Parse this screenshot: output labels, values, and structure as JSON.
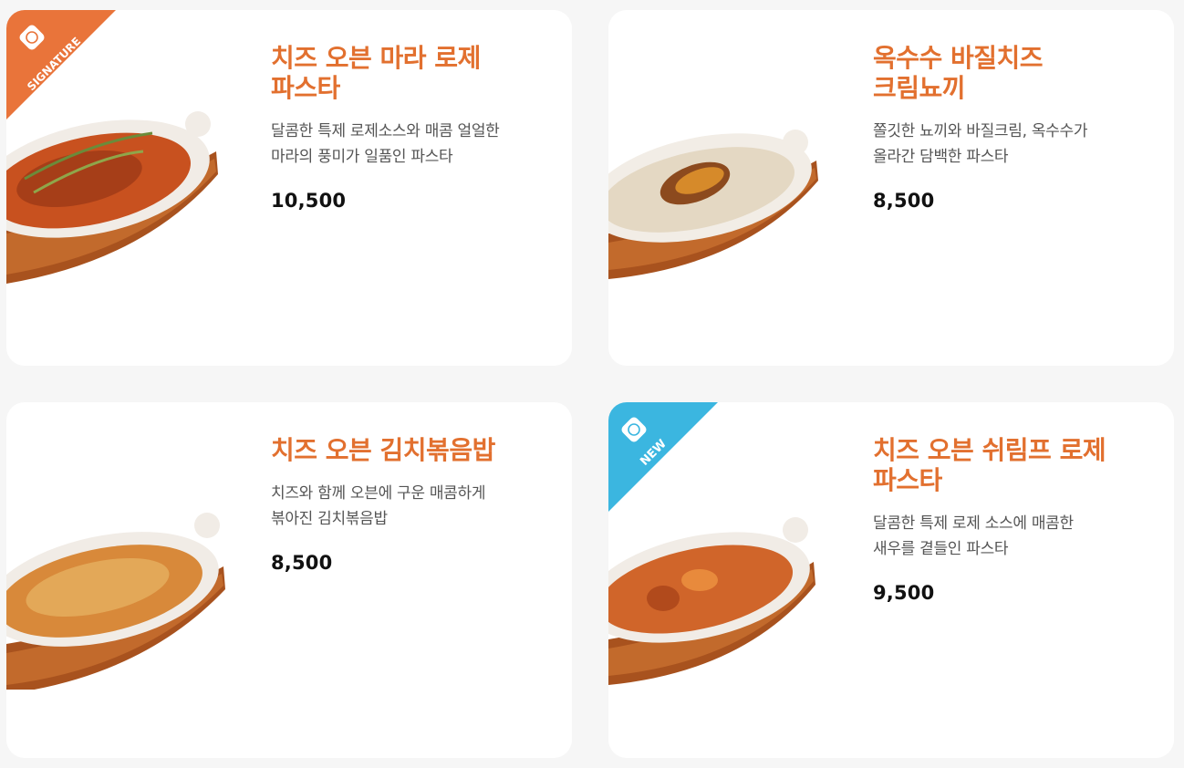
{
  "colors": {
    "title": "#e2702f",
    "signature_badge": "#e9743a",
    "new_badge": "#3bb6e0"
  },
  "menu": [
    {
      "title_lines": [
        "치즈 오븐 마라 로제",
        "파스타"
      ],
      "desc_lines": [
        "달콤한 특제 로제소스와 매콤 얼얼한",
        "마라의 풍미가 일품인 파스타"
      ],
      "price": "10,500",
      "badge": "SIGNATURE"
    },
    {
      "title_lines": [
        "옥수수 바질치즈",
        "크림뇨끼"
      ],
      "desc_lines": [
        "쫄깃한 뇨끼와 바질크림, 옥수수가",
        "올라간 담백한 파스타"
      ],
      "price": "8,500",
      "badge": ""
    },
    {
      "title_lines": [
        "치즈 오븐 김치볶음밥"
      ],
      "desc_lines": [
        "치즈와 함께 오븐에 구운 매콤하게",
        "볶아진 김치볶음밥"
      ],
      "price": "8,500",
      "badge": ""
    },
    {
      "title_lines": [
        "치즈 오븐 쉬림프 로제",
        "파스타"
      ],
      "desc_lines": [
        "달콤한 특제 로제 소스에 매콤한",
        "새우를 곁들인 파스타"
      ],
      "price": "9,500",
      "badge": "NEW"
    }
  ]
}
